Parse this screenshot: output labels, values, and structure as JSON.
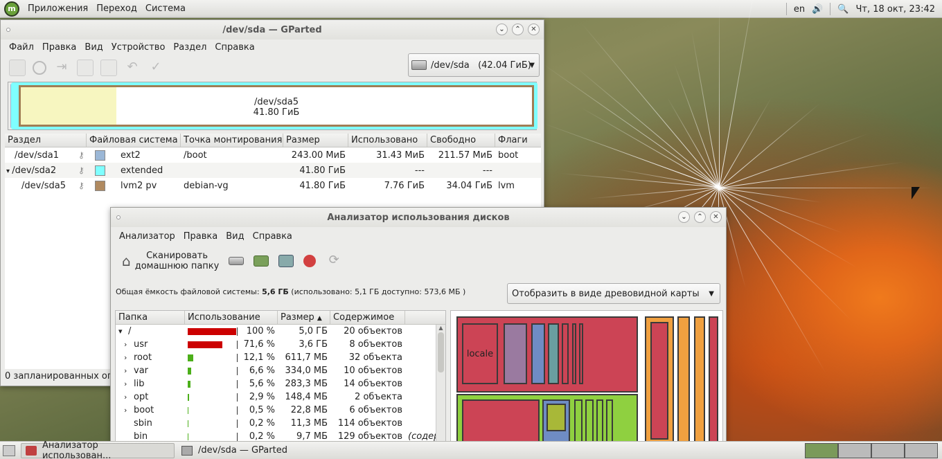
{
  "top_panel": {
    "menu": [
      "Приложения",
      "Переход",
      "Система"
    ],
    "lang": "en",
    "clock": "Чт, 18 окт, 23:42"
  },
  "gparted": {
    "title": "/dev/sda — GParted",
    "menu": [
      "Файл",
      "Правка",
      "Вид",
      "Устройство",
      "Раздел",
      "Справка"
    ],
    "device": "/dev/sda   (42.04 ГиБ)",
    "map_label": "/dev/sda5",
    "map_size": "41.80 ГиБ",
    "columns": [
      "Раздел",
      "Файловая система",
      "Точка монтирования",
      "Размер",
      "Использовано",
      "Свободно",
      "Флаги"
    ],
    "rows": [
      {
        "name": "/dev/sda1",
        "fs": "ext2",
        "color": "#9bb7d6",
        "mount": "/boot",
        "size": "243.00 МиБ",
        "used": "31.43 МиБ",
        "free": "211.57 МиБ",
        "flags": "boot"
      },
      {
        "name": "/dev/sda2",
        "fs": "extended",
        "color": "#7fffff",
        "mount": "",
        "size": "41.80 ГиБ",
        "used": "---",
        "free": "---",
        "flags": ""
      },
      {
        "name": "/dev/sda5",
        "fs": "lvm2 pv",
        "color": "#b08a60",
        "mount": "debian-vg",
        "size": "41.80 ГиБ",
        "used": "7.76 ГиБ",
        "free": "34.04 ГиБ",
        "flags": "lvm"
      }
    ],
    "status": "0 запланированных оп"
  },
  "baobab": {
    "title": "Анализатор использования дисков",
    "menu": [
      "Анализатор",
      "Правка",
      "Вид",
      "Справка"
    ],
    "scan_home_line1": "Сканировать",
    "scan_home_line2": "домашнюю папку",
    "capacity_prefix": "Общая ёмкость файловой системы:",
    "capacity_value": "5,6 ГБ",
    "capacity_suffix": "(использовано: 5,1 ГБ доступно: 573,6 МБ )",
    "view_mode": "Отобразить в виде древовидной карты",
    "columns": [
      "Папка",
      "Использование",
      "Размер",
      "Содержимое"
    ],
    "treemap_label": "locale",
    "rows": [
      {
        "arrow": "▾",
        "name": "/",
        "pct": "100 %",
        "pct_value": 100,
        "size": "5,0 ГБ",
        "items": "20 объектов",
        "color": "#cc0000",
        "indent": 0
      },
      {
        "arrow": "›",
        "name": "usr",
        "pct": "71,6 %",
        "pct_value": 71.6,
        "size": "3,6 ГБ",
        "items": "8 объектов",
        "color": "#cc0000",
        "indent": 1
      },
      {
        "arrow": "›",
        "name": "root",
        "pct": "12,1 %",
        "pct_value": 12.1,
        "size": "611,7 МБ",
        "items": "32 объекта",
        "color": "#4caf1a",
        "indent": 1
      },
      {
        "arrow": "›",
        "name": "var",
        "pct": "6,6 %",
        "pct_value": 6.6,
        "size": "334,0 МБ",
        "items": "10 объектов",
        "color": "#4caf1a",
        "indent": 1
      },
      {
        "arrow": "›",
        "name": "lib",
        "pct": "5,6 %",
        "pct_value": 5.6,
        "size": "283,3 МБ",
        "items": "14 объектов",
        "color": "#4caf1a",
        "indent": 1
      },
      {
        "arrow": "›",
        "name": "opt",
        "pct": "2,9 %",
        "pct_value": 2.9,
        "size": "148,4 МБ",
        "items": "2 объекта",
        "color": "#4caf1a",
        "indent": 1
      },
      {
        "arrow": "›",
        "name": "boot",
        "pct": "0,5 %",
        "pct_value": 0.5,
        "size": "22,8 МБ",
        "items": "6 объектов",
        "color": "#4caf1a",
        "indent": 1
      },
      {
        "arrow": "",
        "name": "sbin",
        "pct": "0,2 %",
        "pct_value": 0.2,
        "size": "11,3 МБ",
        "items": "114 объектов",
        "color": "#4caf1a",
        "indent": 1
      },
      {
        "arrow": "",
        "name": "bin",
        "pct": "0,2 %",
        "pct_value": 0.2,
        "size": "9,7 МБ",
        "items": "129 объектов",
        "extra": "(содер",
        "color": "#4caf1a",
        "indent": 1
      }
    ]
  },
  "taskbar": {
    "tasks": [
      "Анализатор использован...",
      "/dev/sda — GParted"
    ]
  }
}
